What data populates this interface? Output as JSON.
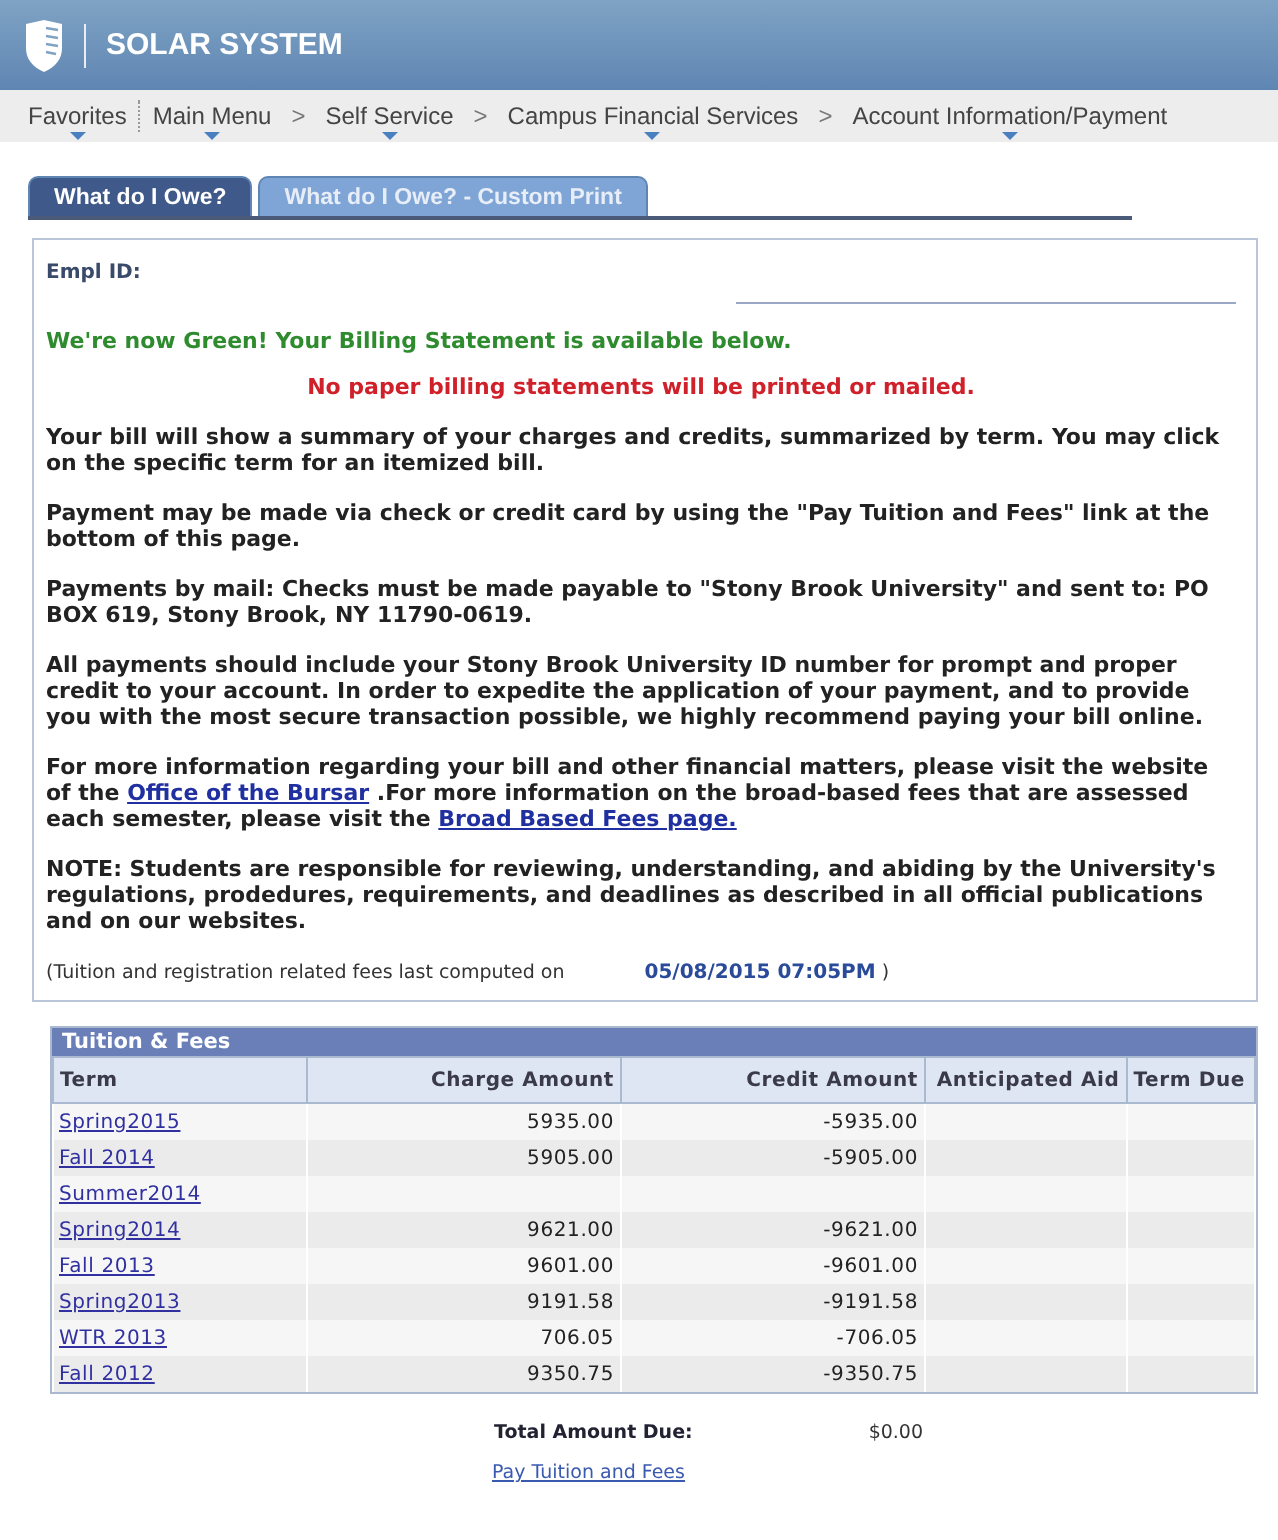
{
  "header": {
    "title": "SOLAR SYSTEM"
  },
  "breadcrumbs": [
    {
      "label": "Favorites"
    },
    {
      "label": "Main Menu"
    },
    {
      "label": "Self Service",
      "separator": ">"
    },
    {
      "label": "Campus Financial Services",
      "separator": ">"
    },
    {
      "label": "Account Information/Payment",
      "separator": ">"
    }
  ],
  "tabs": [
    {
      "label": "What do I Owe?",
      "selected": true
    },
    {
      "label": "What do I Owe? - Custom Print",
      "selected": false
    }
  ],
  "empl_id": {
    "label": "Empl ID:"
  },
  "notices": [
    {
      "kind": "green",
      "text": "We're now Green! Your Billing Statement is available below."
    },
    {
      "kind": "red",
      "text": "No paper billing statements will be printed or mailed."
    }
  ],
  "paragraphs": [
    [
      {
        "text": "Your bill will show a summary of your charges and credits, summarized by term. You may click on the specific term for an itemized bill."
      }
    ],
    [
      {
        "text": "Payment may be made via check or credit card by using the \"Pay Tuition and Fees\" link at the bottom of this page."
      }
    ],
    [
      {
        "text": "Payments by mail: Checks must be made payable to \"Stony Brook University\" and sent to: PO BOX 619, Stony Brook, NY 11790-0619."
      }
    ],
    [
      {
        "text": "All payments should include your Stony Brook University ID number for prompt and proper credit to your account. In order to expedite the application of your payment, and to provide you with the most secure transaction possible, we highly recommend paying your bill online."
      }
    ],
    [
      {
        "text": "For more information regarding your bill and other financial matters, please visit the website of the "
      },
      {
        "text": "Office of the Bursar",
        "kind": "link"
      },
      {
        "text": " .For more information on the broad-based fees that are assessed each semester, please visit the "
      },
      {
        "text": "Broad Based Fees page.",
        "kind": "link"
      }
    ],
    [
      {
        "text": "NOTE: Students are responsible for reviewing, understanding, and abiding by the University's regulations, prodedures, requirements, and deadlines as described in all official publications and on our websites."
      }
    ]
  ],
  "computed": {
    "label": "(Tuition and registration related fees last computed on",
    "value": "05/08/2015 07:05PM",
    "close": ")"
  },
  "table": {
    "title": "Tuition & Fees",
    "columns": [
      "Term",
      "Charge Amount",
      "Credit Amount",
      "Anticipated Aid",
      "Term Due"
    ],
    "rows": [
      [
        "Spring2015",
        "5935.00",
        "-5935.00"
      ],
      [
        "Fall 2014",
        "5905.00",
        "-5905.00"
      ],
      [
        "Summer2014",
        "",
        ""
      ],
      [
        "Spring2014",
        "9621.00",
        "-9621.00"
      ],
      [
        "Fall 2013",
        "9601.00",
        "-9601.00"
      ],
      [
        "Spring2013",
        "9191.58",
        "-9191.58"
      ],
      [
        "WTR 2013",
        "706.05",
        "-706.05"
      ],
      [
        "Fall 2012",
        "9350.75",
        "-9350.75"
      ]
    ]
  },
  "total": {
    "label": "Total Amount Due:",
    "value": "$0.00"
  },
  "pay_link": "Pay Tuition and Fees"
}
